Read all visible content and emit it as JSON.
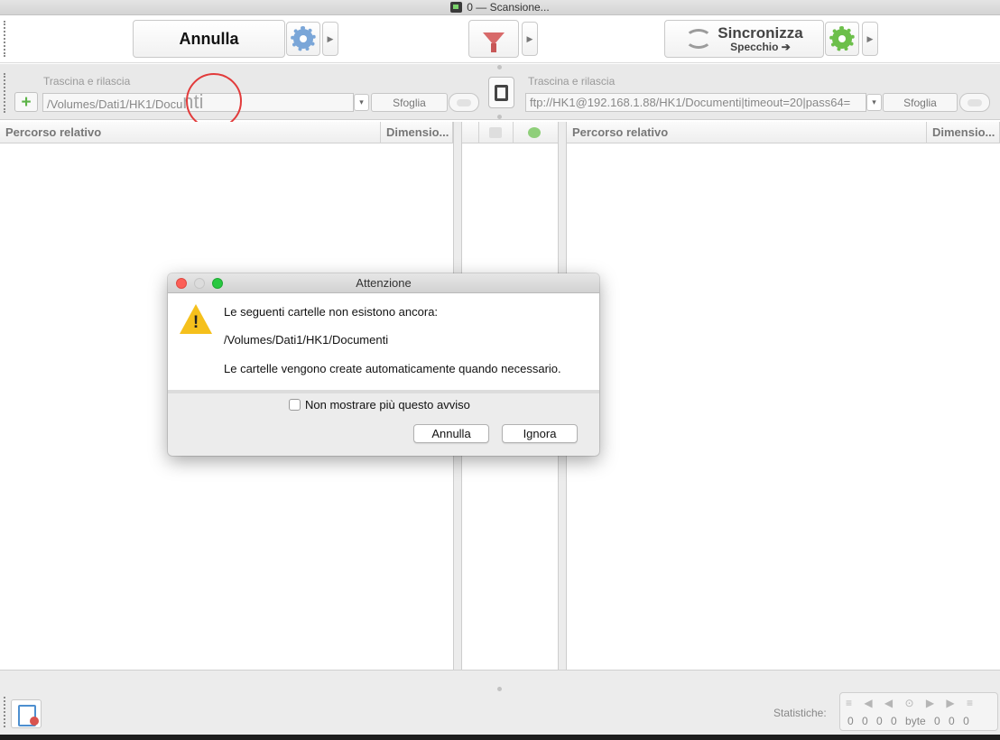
{
  "window": {
    "title": "0 — Scansione..."
  },
  "toolbar": {
    "cancel_label": "Annulla",
    "sync_title": "Sincronizza",
    "sync_variant": "Specchio ➔"
  },
  "left_folder": {
    "label": "Trascina e rilascia",
    "path_prefix": "/Volumes/Dati1/HK1/Docu",
    "path_zoomed": "nti",
    "browse_label": "Sfoglia"
  },
  "right_folder": {
    "label": "Trascina e rilascia",
    "path": "ftp://HK1@192.168.1.88/HK1/Documenti|timeout=20|pass64=",
    "browse_label": "Sfoglia"
  },
  "left_grid": {
    "columns": [
      "Percorso relativo",
      "Dimensio..."
    ]
  },
  "right_grid": {
    "columns": [
      "Percorso relativo",
      "Dimensio..."
    ]
  },
  "dialog": {
    "title": "Attenzione",
    "line1": "Le seguenti cartelle non esistono ancora:",
    "line2": "/Volumes/Dati1/HK1/Documenti",
    "line3": "Le cartelle vengono create automaticamente quando necessario.",
    "checkbox_label": "Non mostrare più questo avviso",
    "cancel_label": "Annulla",
    "ignore_label": "Ignora"
  },
  "status": {
    "stats_label": "Statistiche:",
    "values": "0 0 0 0 byte 0 0 0"
  },
  "colors": {
    "accent_blue": "#7aa6d8",
    "accent_green": "#6cbf4a",
    "warning": "#f5c01c",
    "highlight_circle": "#e23b3b"
  }
}
